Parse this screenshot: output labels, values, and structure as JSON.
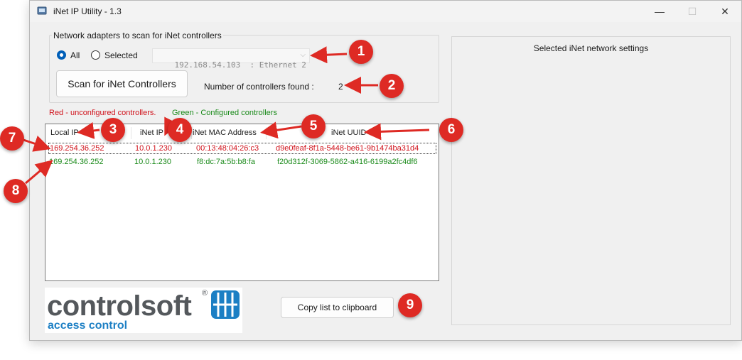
{
  "window": {
    "title": "iNet IP Utility  -  1.3",
    "controls": {
      "minimize": "—",
      "maximize": "☐",
      "close": "✕"
    }
  },
  "adapters": {
    "legend": "Network adapters to scan for iNet  controllers",
    "radio_all": "All",
    "radio_selected": "Selected",
    "selected_radio": "All",
    "adapter_value": "192.168.54.103  : Ethernet 2",
    "scan_button": "Scan for iNet Controllers",
    "found_label": "Number of controllers found :",
    "found_value": "2"
  },
  "legend": {
    "red": "Red - unconfigured controllers.",
    "green": "Green - Configured controllers"
  },
  "table": {
    "columns": [
      "Local IP",
      "iNet IP",
      "iNet MAC Address",
      "iNet UUID"
    ],
    "rows": [
      {
        "local_ip": "169.254.36.252",
        "inet_ip": "10.0.1.230",
        "mac": "00:13:48:04:26:c3",
        "uuid": "d9e0feaf-8f1a-5448-be61-9b1474ba31d4",
        "status": "unconfigured",
        "selected": true
      },
      {
        "local_ip": "169.254.36.252",
        "inet_ip": "10.0.1.230",
        "mac": "f8:dc:7a:5b:b8:fa",
        "uuid": "f20d312f-3069-5862-a416-6199a2fc4df6",
        "status": "configured",
        "selected": false
      }
    ]
  },
  "logo": {
    "name": "controlsoft",
    "registered": "®",
    "tagline": "access control"
  },
  "copy_button": "Copy list to clipboard",
  "right_panel": {
    "title": "Selected iNet network settings"
  },
  "annotations": [
    "1",
    "2",
    "3",
    "4",
    "5",
    "6",
    "7",
    "8",
    "9"
  ],
  "colors": {
    "unconfigured": "#d0121b",
    "configured": "#1a8a1a",
    "accent": "#005fb8",
    "marker": "#de2a24",
    "logo_grey": "#54585c",
    "logo_blue": "#1c7fc4"
  }
}
